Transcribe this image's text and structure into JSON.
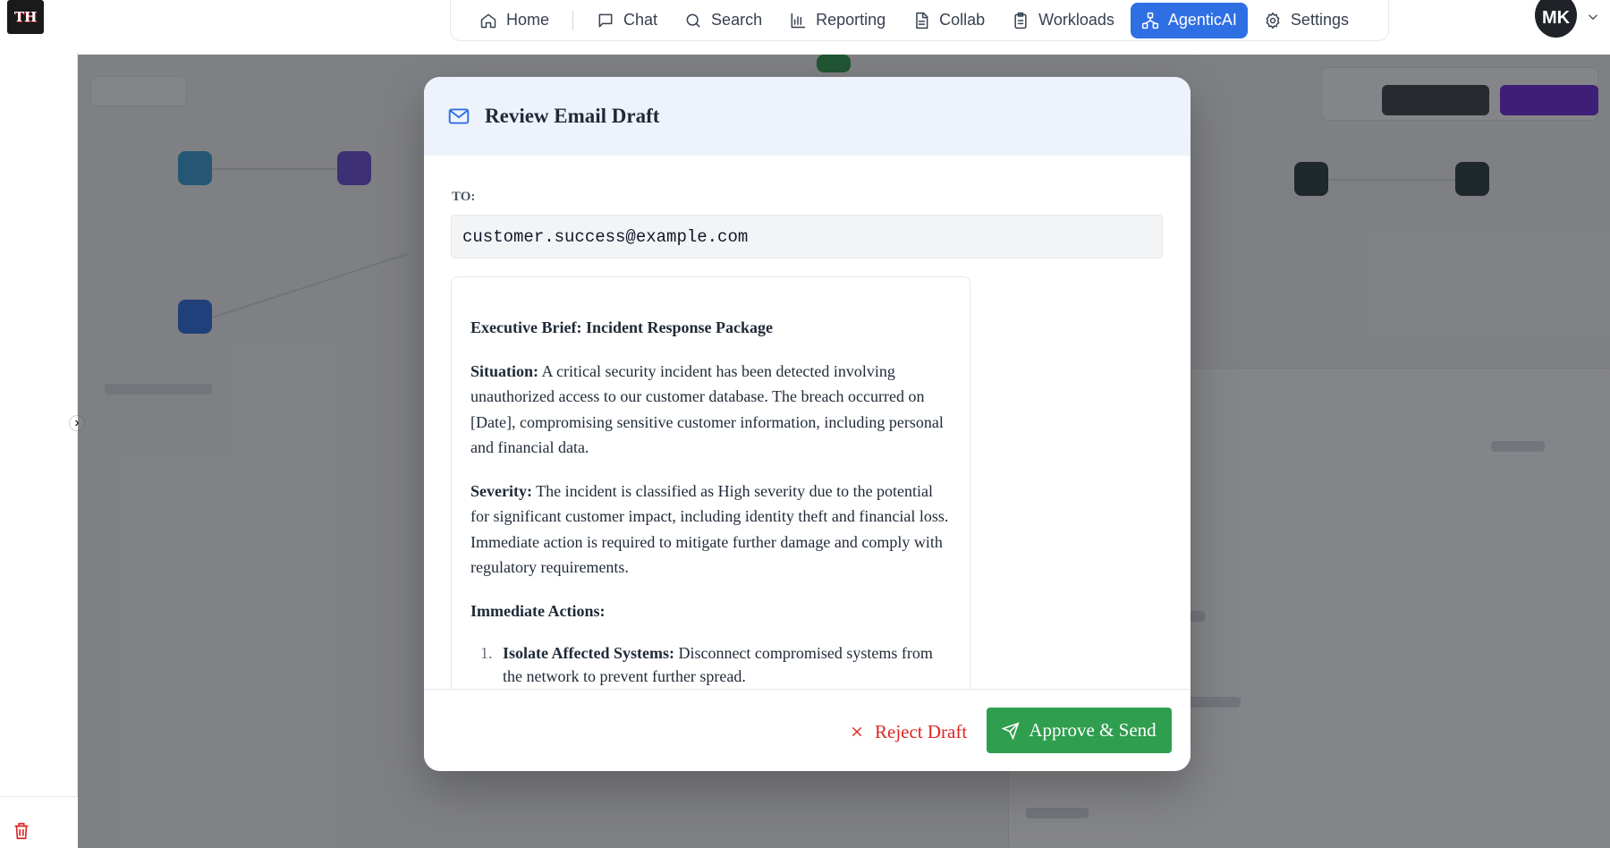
{
  "app": {
    "logo_text": "TH"
  },
  "nav": {
    "items": [
      {
        "label": "Home",
        "icon": "home-icon"
      },
      {
        "label": "Chat",
        "icon": "chat-icon"
      },
      {
        "label": "Search",
        "icon": "search-icon"
      },
      {
        "label": "Reporting",
        "icon": "bar-chart-icon"
      },
      {
        "label": "Collab",
        "icon": "document-icon"
      },
      {
        "label": "Workloads",
        "icon": "clipboard-icon"
      },
      {
        "label": "AgenticAI",
        "icon": "network-icon",
        "active": true
      },
      {
        "label": "Settings",
        "icon": "gear-icon"
      }
    ]
  },
  "user": {
    "initials": "MK"
  },
  "modal": {
    "title": "Review Email Draft",
    "to_label": "TO:",
    "to_value": "customer.success@example.com",
    "body": {
      "heading": "Executive Brief: Incident Response Package",
      "situation_label": "Situation:",
      "situation_text": "A critical security incident has been detected involving unauthorized access to our customer database. The breach occurred on [Date], compromising sensitive customer information, including personal and financial data.",
      "severity_label": "Severity:",
      "severity_text": "The incident is classified as High severity due to the potential for significant customer impact, including identity theft and financial loss. Immediate action is required to mitigate further damage and comply with regulatory requirements.",
      "actions_heading": "Immediate Actions:",
      "actions": [
        {
          "num": "1.",
          "label": "Isolate Affected Systems:",
          "text": "Disconnect compromised systems from the network to prevent further spread."
        }
      ]
    },
    "reject_label": "Reject Draft",
    "approve_label": "Approve & Send"
  },
  "colors": {
    "accent": "#2f6fe4",
    "approve": "#2f9e4f",
    "reject": "#dc2626",
    "header_bg": "#eef3fb"
  }
}
